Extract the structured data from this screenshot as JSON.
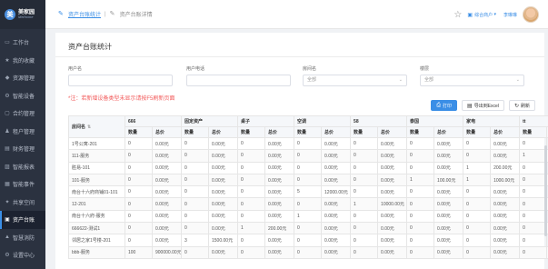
{
  "app": {
    "logo_mark": "美",
    "logo_cn": "美家园",
    "logo_en": "Meihome"
  },
  "sidebar": {
    "items": [
      {
        "label": "工作台",
        "icon": "desktop-icon"
      },
      {
        "label": "我的收藏",
        "icon": "star-icon"
      },
      {
        "label": "资源管理",
        "icon": "resource-icon"
      },
      {
        "label": "智能设备",
        "icon": "device-icon"
      },
      {
        "label": "合约管理",
        "icon": "contract-icon"
      },
      {
        "label": "租户管理",
        "icon": "tenant-icon"
      },
      {
        "label": "财务管理",
        "icon": "finance-icon"
      },
      {
        "label": "智能报表",
        "icon": "report-icon"
      },
      {
        "label": "智能事件",
        "icon": "event-icon"
      },
      {
        "label": "共享空间",
        "icon": "share-icon"
      },
      {
        "label": "资产台账",
        "icon": "asset-icon",
        "active": true
      },
      {
        "label": "智慧消防",
        "icon": "fire-icon"
      },
      {
        "label": "设置中心",
        "icon": "settings-icon"
      }
    ]
  },
  "header": {
    "breadcrumb_link": "资产台账统计",
    "breadcrumb_current": "资产台账详情",
    "tenant_label": "综合商户",
    "username": "李琳琳"
  },
  "page": {
    "title": "资产台账统计",
    "note": "*注：若新增设备类型未显示请按F5刷新页面"
  },
  "filters": [
    {
      "label": "用户名",
      "placeholder": "",
      "type": "input"
    },
    {
      "label": "用户电话",
      "placeholder": "",
      "type": "input"
    },
    {
      "label": "房间名",
      "value": "全部",
      "type": "select"
    },
    {
      "label": "楼层",
      "value": "全部",
      "type": "select"
    }
  ],
  "buttons": {
    "print": "打印",
    "export": "导出到Excel",
    "refresh": "刷新"
  },
  "table": {
    "room_header": "房间名",
    "groups": [
      "666",
      "固定资产",
      "桌子",
      "空调",
      "58",
      "泰国",
      "家电",
      "tt"
    ],
    "sub_headers": [
      "数量",
      "总价"
    ],
    "rows": [
      {
        "room": "1号公寓-201",
        "cells": [
          "0",
          "0.00元",
          "0",
          "0.00元",
          "0",
          "0.00元",
          "0",
          "0.00元",
          "0",
          "0.00元",
          "0",
          "0.00元",
          "0",
          "0.00元",
          "0",
          "0.00元"
        ]
      },
      {
        "room": "111-服务",
        "cells": [
          "0",
          "0.00元",
          "0",
          "0.00元",
          "0",
          "0.00元",
          "0",
          "0.00元",
          "0",
          "0.00元",
          "0",
          "0.00元",
          "0",
          "0.00元",
          "1",
          "22.00元"
        ]
      },
      {
        "room": "胜易-101",
        "cells": [
          "0",
          "0.00元",
          "0",
          "0.00元",
          "0",
          "0.00元",
          "0",
          "0.00元",
          "0",
          "0.00元",
          "0",
          "0.00元",
          "1",
          "200.00元",
          "0",
          "0.00元"
        ]
      },
      {
        "room": "101-服务",
        "cells": [
          "0",
          "0.00元",
          "0",
          "0.00元",
          "0",
          "0.00元",
          "0",
          "0.00元",
          "0",
          "0.00元",
          "1",
          "100.00元",
          "1",
          "1000.00元",
          "0",
          "0.00元"
        ]
      },
      {
        "room": "南台十六府商铺01-101",
        "cells": [
          "0",
          "0.00元",
          "0",
          "0.00元",
          "0",
          "0.00元",
          "5",
          "12000.00元",
          "0",
          "0.00元",
          "0",
          "0.00元",
          "0",
          "0.00元",
          "0",
          "0.00元"
        ]
      },
      {
        "room": "12-201",
        "cells": [
          "0",
          "0.00元",
          "0",
          "0.00元",
          "0",
          "0.00元",
          "0",
          "0.00元",
          "1",
          "10000.00元",
          "0",
          "0.00元",
          "0",
          "0.00元",
          "0",
          "0.00元"
        ]
      },
      {
        "room": "南台十六府-服务",
        "cells": [
          "0",
          "0.00元",
          "0",
          "0.00元",
          "0",
          "0.00元",
          "1",
          "0.00元",
          "0",
          "0.00元",
          "0",
          "0.00元",
          "0",
          "0.00元",
          "0",
          "0.00元"
        ]
      },
      {
        "room": "666622-测试1",
        "cells": [
          "0",
          "0.00元",
          "0",
          "0.00元",
          "1",
          "200.00元",
          "0",
          "0.00元",
          "0",
          "0.00元",
          "0",
          "0.00元",
          "0",
          "0.00元",
          "0",
          "0.00元"
        ]
      },
      {
        "room": "邻居之家1号楼-201",
        "cells": [
          "0",
          "0.00元",
          "3",
          "1500.00元",
          "0",
          "0.00元",
          "0",
          "0.00元",
          "0",
          "0.00元",
          "0",
          "0.00元",
          "0",
          "0.00元",
          "0",
          "0.00元"
        ]
      },
      {
        "room": "bbb-服务",
        "cells": [
          "100",
          "900000.00元",
          "0",
          "0.00元",
          "0",
          "0.00元",
          "0",
          "0.00元",
          "0",
          "0.00元",
          "0",
          "0.00元",
          "0",
          "0.00元",
          "0",
          "0.00元"
        ]
      }
    ]
  },
  "colors": {
    "sidebar_bg": "#2b3240",
    "accent": "#3a8ee6",
    "note_red": "#f25a5a"
  }
}
